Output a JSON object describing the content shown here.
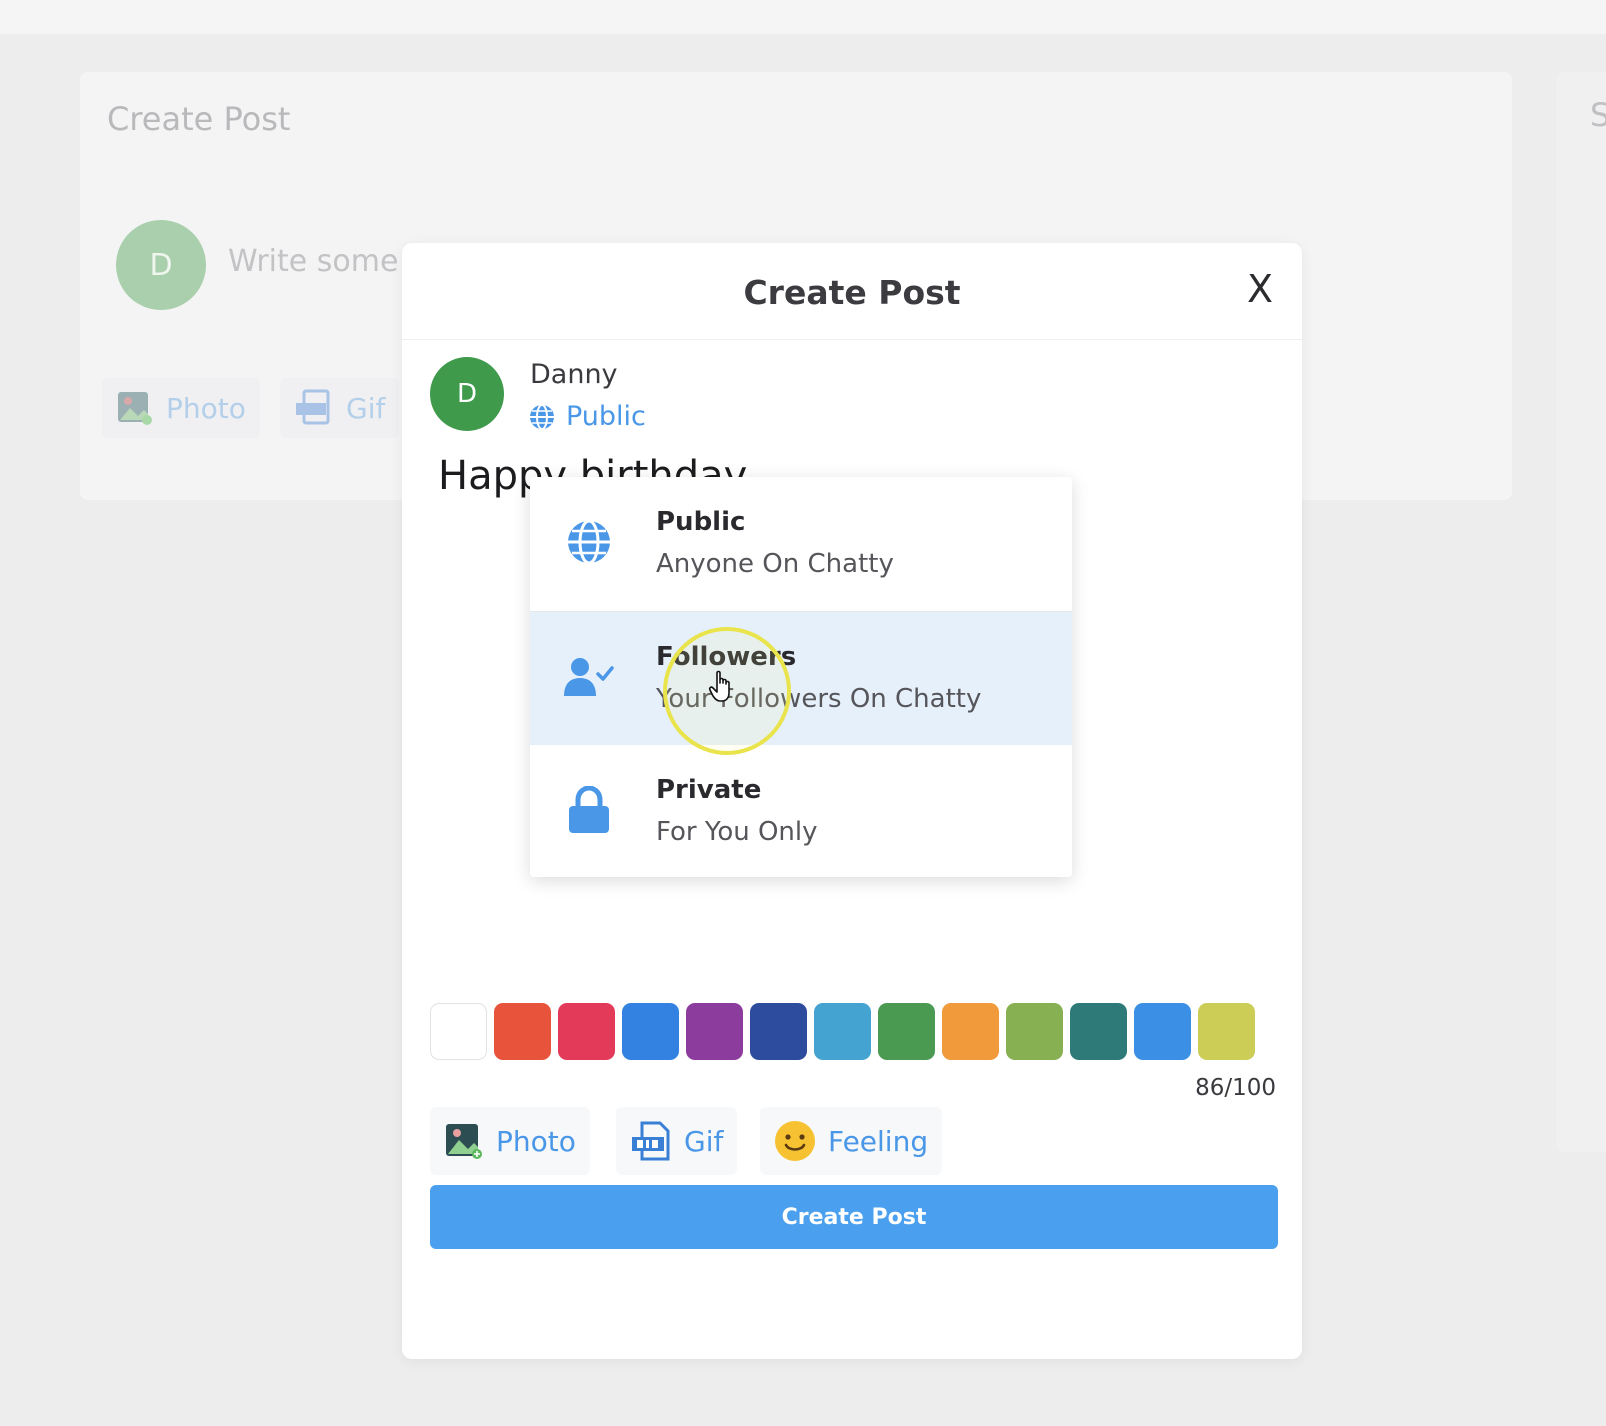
{
  "background": {
    "card_title": "Create Post",
    "avatar_initial": "D",
    "input_placeholder": "Write some",
    "photo_label": "Photo",
    "gif_label": "Gif",
    "side_letter": "S"
  },
  "modal": {
    "title": "Create Post",
    "close_label": "X",
    "user": {
      "initial": "D",
      "name": "Danny",
      "privacy": "Public"
    },
    "post_text": "Happy birthday",
    "privacy_menu": [
      {
        "label": "Public",
        "description": "Anyone On Chatty",
        "icon": "globe-icon"
      },
      {
        "label": "Followers",
        "description": "Your Followers On Chatty",
        "icon": "user-check-icon"
      },
      {
        "label": "Private",
        "description": "For You Only",
        "icon": "lock-icon"
      }
    ],
    "selected_privacy_hover": "Followers",
    "colors": [
      "#ffffff",
      "#e8533c",
      "#e23a58",
      "#3382e1",
      "#8c3c9c",
      "#2e4c9e",
      "#44a3d0",
      "#4a9a52",
      "#f09a3c",
      "#86b051",
      "#2e7a78",
      "#3b8fe4",
      "#cbcd57"
    ],
    "char_count": "86/100",
    "actions": {
      "photo": "Photo",
      "gif": "Gif",
      "feeling": "Feeling"
    },
    "submit_label": "Create Post"
  },
  "accent_color": "#4aa0ee"
}
